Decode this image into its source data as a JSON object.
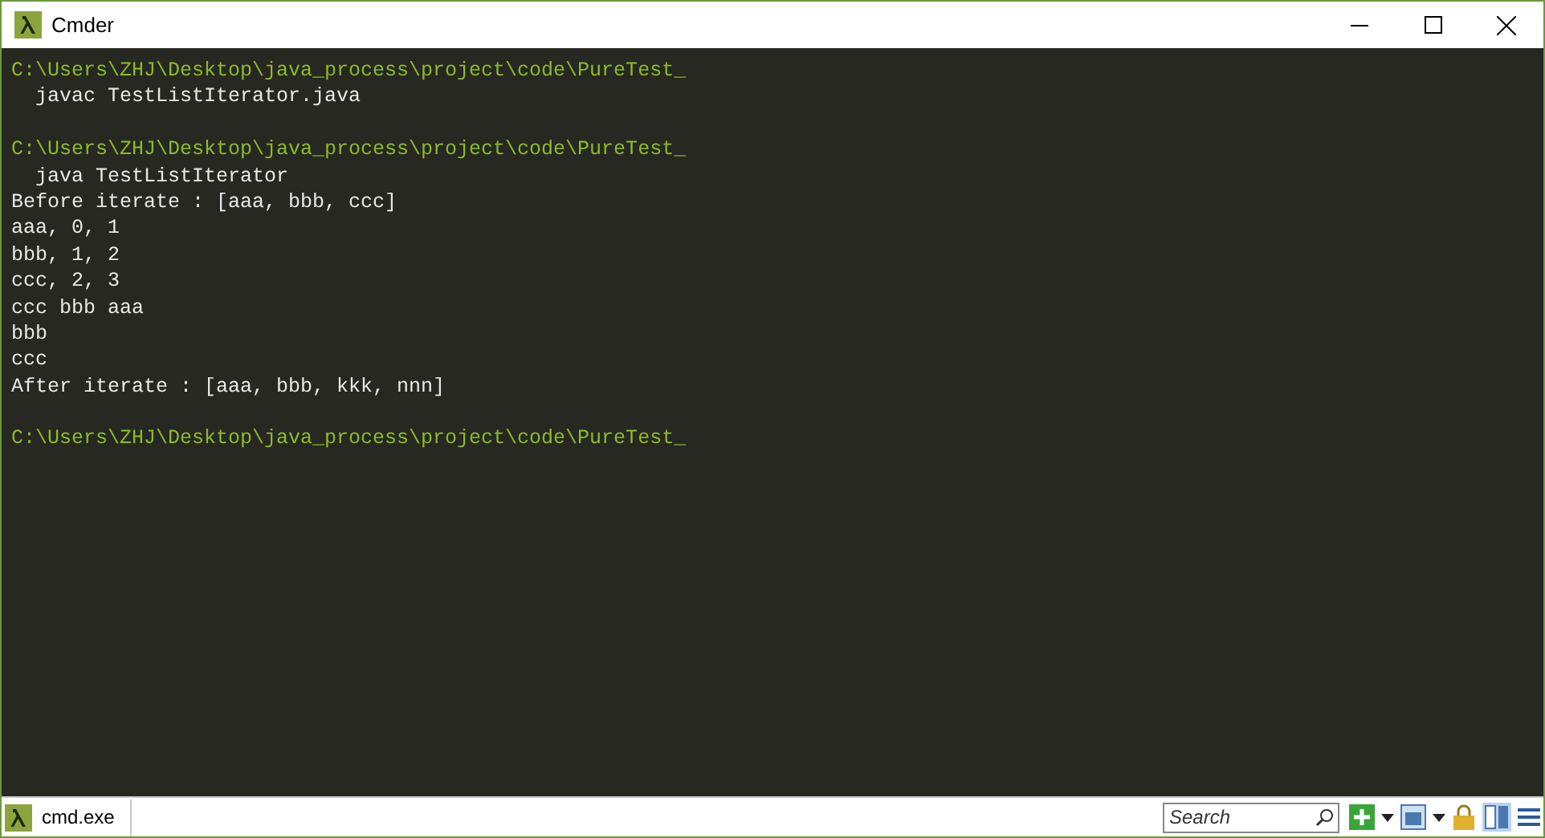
{
  "window": {
    "title": "Cmder"
  },
  "console": [
    {
      "kind": "prompt",
      "text": "C:\\Users\\ZHJ\\Desktop\\java_process\\project\\code\\PureTest_"
    },
    {
      "kind": "output",
      "text": "  javac TestListIterator.java"
    },
    {
      "kind": "blank"
    },
    {
      "kind": "prompt",
      "text": "C:\\Users\\ZHJ\\Desktop\\java_process\\project\\code\\PureTest_"
    },
    {
      "kind": "output",
      "text": "  java TestListIterator"
    },
    {
      "kind": "output",
      "text": "Before iterate : [aaa, bbb, ccc]"
    },
    {
      "kind": "output",
      "text": "aaa, 0, 1"
    },
    {
      "kind": "output",
      "text": "bbb, 1, 2"
    },
    {
      "kind": "output",
      "text": "ccc, 2, 3"
    },
    {
      "kind": "output",
      "text": "ccc bbb aaa"
    },
    {
      "kind": "output",
      "text": "bbb"
    },
    {
      "kind": "output",
      "text": "ccc"
    },
    {
      "kind": "output",
      "text": "After iterate : [aaa, bbb, kkk, nnn]"
    },
    {
      "kind": "blank"
    },
    {
      "kind": "prompt",
      "text": "C:\\Users\\ZHJ\\Desktop\\java_process\\project\\code\\PureTest_"
    }
  ],
  "status_bar": {
    "tabs": [
      {
        "label": "cmd.exe",
        "selected": true
      }
    ],
    "search": {
      "placeholder": "Search"
    }
  }
}
